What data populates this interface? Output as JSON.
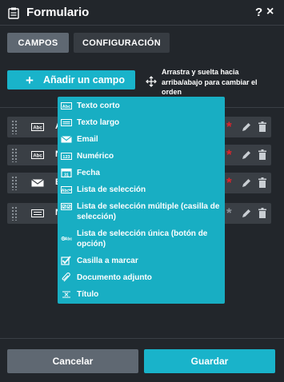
{
  "header": {
    "title": "Formulario",
    "help_label": "?",
    "close_label": "×"
  },
  "tabs": [
    {
      "label": "CAMPOS",
      "active": true
    },
    {
      "label": "CONFIGURACIÓN",
      "active": false
    }
  ],
  "toolbar": {
    "add_plus": "+",
    "add_label": "Añadir un campo",
    "hint": "Arrastra y suelta hacia arriba/abajo para cambiar el orden"
  },
  "fields": [
    {
      "icon": "short-text-icon",
      "name": "A",
      "required": true
    },
    {
      "icon": "short-text-icon",
      "name": "N",
      "required": true
    },
    {
      "icon": "email-icon",
      "name": "E",
      "required": true
    },
    {
      "icon": "long-text-icon",
      "name": "N",
      "required": false
    }
  ],
  "dropdown": {
    "items": [
      {
        "icon": "short-text-icon",
        "label": "Texto corto"
      },
      {
        "icon": "long-text-icon",
        "label": "Texto largo"
      },
      {
        "icon": "email-icon",
        "label": "Email"
      },
      {
        "icon": "numeric-icon",
        "label": "Numérico"
      },
      {
        "icon": "calendar-icon",
        "label": "Fecha"
      },
      {
        "icon": "select-list-icon",
        "label": "Lista de selección"
      },
      {
        "icon": "multi-select-icon",
        "label": "Lista de selección múltiple (casilla de selección)"
      },
      {
        "icon": "single-select-icon",
        "label": "Lista de selección única (botón de opción)"
      },
      {
        "icon": "checkbox-icon",
        "label": "Casilla a marcar"
      },
      {
        "icon": "paperclip-icon",
        "label": "Documento adjunto"
      },
      {
        "icon": "title-icon",
        "label": "Título"
      }
    ]
  },
  "footer": {
    "cancel_label": "Cancelar",
    "save_label": "Guardar"
  },
  "colors": {
    "accent": "#19b3ca",
    "required": "#e0242c",
    "optional": "#8b9299",
    "background": "#22262b"
  }
}
